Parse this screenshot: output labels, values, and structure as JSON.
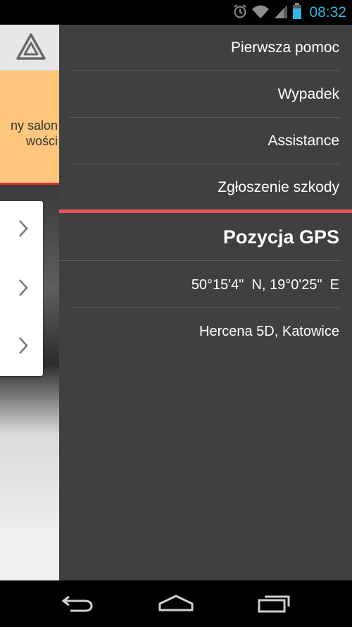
{
  "status_bar": {
    "time": "08:32",
    "icons": [
      "alarm-icon",
      "wifi-icon",
      "signal-icon",
      "battery-icon"
    ],
    "time_color": "#33b5e5"
  },
  "background_app": {
    "banner_text_line1": "ny salon",
    "banner_text_line2": "wości",
    "banner_color": "#fec77d",
    "banner_border_color": "#d4352f"
  },
  "drawer": {
    "background_color": "#3e4042",
    "accent_color": "#e8555b",
    "menu_items": [
      {
        "label": "Pierwsza pomoc"
      },
      {
        "label": "Wypadek"
      },
      {
        "label": "Assistance"
      },
      {
        "label": "Zgłoszenie szkody"
      }
    ],
    "gps": {
      "title": "Pozycja GPS",
      "coordinates": "50°15'4\"  N, 19°0'25\"  E",
      "address": "Hercena 5D, Katowice"
    }
  },
  "nav_bar": {
    "buttons": [
      "back-icon",
      "home-icon",
      "recent-apps-icon"
    ]
  }
}
